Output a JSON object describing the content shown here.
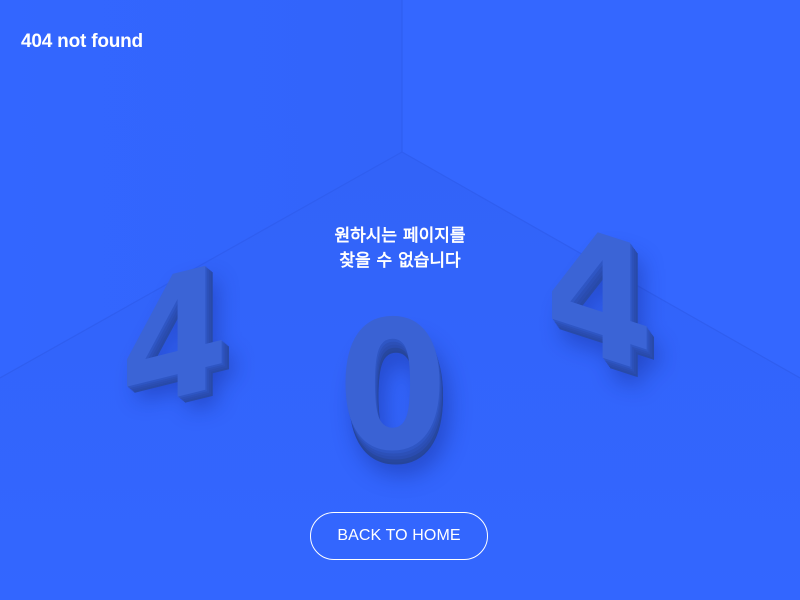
{
  "page": {
    "title": "404 not found",
    "background_color": "#3366ff"
  },
  "message": {
    "line1": "원하시는 페이지를",
    "line2": "찾을 수 없습니다"
  },
  "digits": {
    "first": "4",
    "second": "0",
    "third": "4",
    "color": "#3b64d6"
  },
  "button": {
    "label": "BACK TO HOME"
  }
}
